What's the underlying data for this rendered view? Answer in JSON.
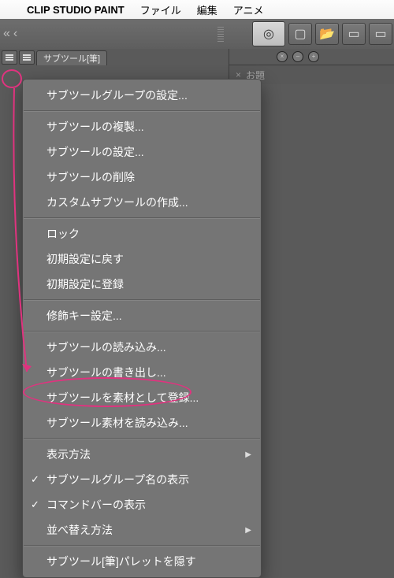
{
  "menubar": {
    "app_name": "CLIP STUDIO PAINT",
    "items": [
      "ファイル",
      "編集",
      "アニメ"
    ]
  },
  "palette": {
    "tab_label": "サブツール[筆]"
  },
  "right_panel": {
    "section1_label": "お題"
  },
  "context_menu": {
    "items": [
      {
        "label": "サブツールグループの設定...",
        "type": "item"
      },
      {
        "type": "sep"
      },
      {
        "label": "サブツールの複製...",
        "type": "item"
      },
      {
        "label": "サブツールの設定...",
        "type": "item"
      },
      {
        "label": "サブツールの削除",
        "type": "item"
      },
      {
        "label": "カスタムサブツールの作成...",
        "type": "item"
      },
      {
        "type": "sep"
      },
      {
        "label": "ロック",
        "type": "item"
      },
      {
        "label": "初期設定に戻す",
        "type": "item"
      },
      {
        "label": "初期設定に登録",
        "type": "item"
      },
      {
        "type": "sep"
      },
      {
        "label": "修飾キー設定...",
        "type": "item"
      },
      {
        "type": "sep"
      },
      {
        "label": "サブツールの読み込み...",
        "type": "item",
        "highlight": true
      },
      {
        "label": "サブツールの書き出し...",
        "type": "item"
      },
      {
        "label": "サブツールを素材として登録...",
        "type": "item"
      },
      {
        "label": "サブツール素材を読み込み...",
        "type": "item"
      },
      {
        "type": "sep"
      },
      {
        "label": "表示方法",
        "type": "item",
        "submenu": true
      },
      {
        "label": "サブツールグループ名の表示",
        "type": "item",
        "checked": true
      },
      {
        "label": "コマンドバーの表示",
        "type": "item",
        "checked": true
      },
      {
        "label": "並べ替え方法",
        "type": "item",
        "submenu": true
      },
      {
        "type": "sep"
      },
      {
        "label": "サブツール[筆]パレットを隠す",
        "type": "item"
      }
    ]
  }
}
